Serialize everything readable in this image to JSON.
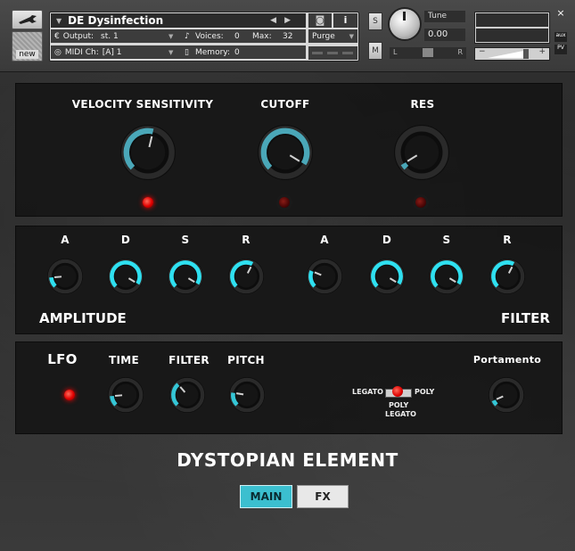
{
  "header": {
    "instrument_name": "DE Dysinfection",
    "output_label": "Output:",
    "output_value": "st. 1",
    "voices_label": "Voices:",
    "voices_value": "0",
    "max_label": "Max:",
    "max_value": "32",
    "midi_label": "MIDI Ch:",
    "midi_value": "[A]  1",
    "memory_label": "Memory:",
    "memory_value": "0",
    "purge_label": "Purge",
    "new_label": "new",
    "solo_label": "S",
    "mute_label": "M",
    "tune_label": "Tune",
    "tune_value": "0.00",
    "pan_left": "L",
    "pan_right": "R",
    "aux_label": "aux",
    "pv_label": "PV",
    "close_label": "×"
  },
  "top_panel": {
    "velocity_label": "VELOCITY  SENSITIVITY",
    "cutoff_label": "CUTOFF",
    "res_label": "RES",
    "velocity_level": 0.55,
    "cutoff_level": 0.95,
    "res_level": 0.05
  },
  "envelope_panel": {
    "amp_letters": [
      "A",
      "D",
      "S",
      "R"
    ],
    "filter_letters": [
      "A",
      "D",
      "S",
      "R"
    ],
    "amplitude_label": "AMPLITUDE",
    "filter_label": "FILTER",
    "amp_levels": [
      0.15,
      0.95,
      0.95,
      0.6
    ],
    "filter_levels": [
      0.25,
      0.95,
      0.95,
      0.6
    ]
  },
  "lfo_panel": {
    "lfo_label": "LFO",
    "time_label": "TIME",
    "filter_label": "FILTER",
    "pitch_label": "PITCH",
    "legato_label": "LEGATO",
    "poly_label": "POLY",
    "poly_legato_label_1": "POLY",
    "poly_legato_label_2": "LEGATO",
    "portamento_label": "Portamento",
    "time_level": 0.15,
    "filter_level": 0.35,
    "pitch_level": 0.2,
    "portamento_level": 0.08
  },
  "footer": {
    "product_title": "DYSTOPIAN ELEMENT",
    "tab_main": "MAIN",
    "tab_fx": "FX"
  },
  "colors": {
    "accent": "#3bbfcf",
    "knob_arc": "#4aa7b8",
    "led_on": "#e00000"
  }
}
